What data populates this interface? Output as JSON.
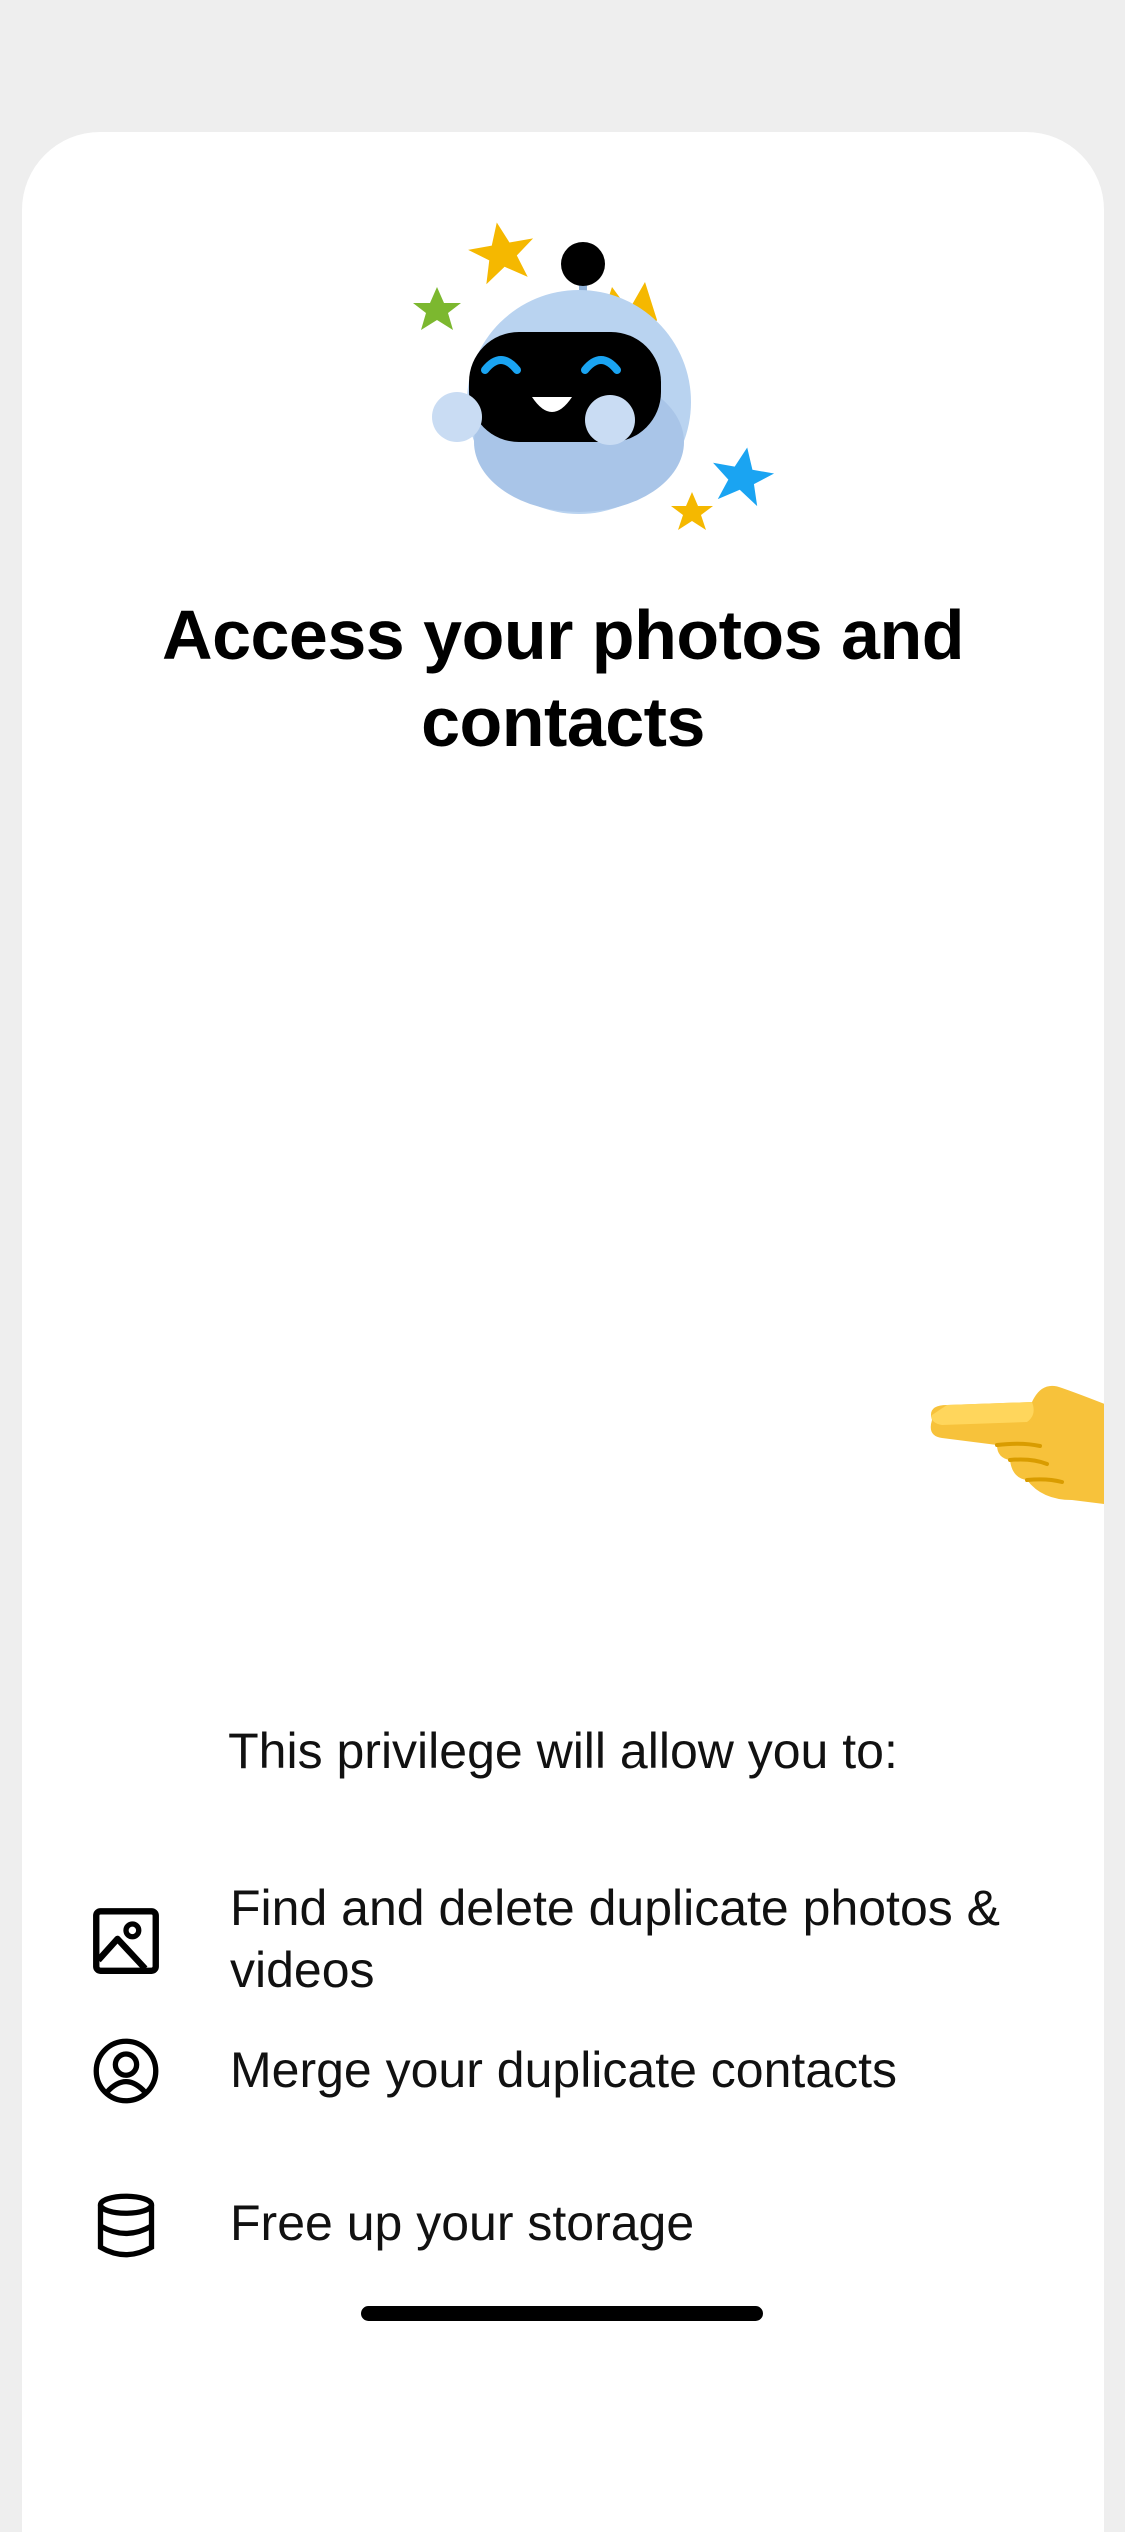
{
  "screen": {
    "title": "Access your photos and contacts",
    "subtitle": "This privilege will allow you to:"
  },
  "features": [
    {
      "icon": "photo-icon",
      "text": "Find and delete duplicate photos & videos"
    },
    {
      "icon": "user-circle-icon",
      "text": "Merge your duplicate contacts"
    },
    {
      "icon": "database-icon",
      "text": "Free up your storage"
    }
  ],
  "illustration": {
    "icon": "robot-mascot-icon"
  },
  "pointer": {
    "icon": "pointing-hand-icon"
  },
  "colors": {
    "background": "#eeeeee",
    "sheet": "#ffffff",
    "text": "#000000",
    "star_yellow": "#f5b800",
    "star_blue": "#1aa4f2",
    "star_green": "#7cb82f",
    "robot_body": "#b9d3f0"
  }
}
